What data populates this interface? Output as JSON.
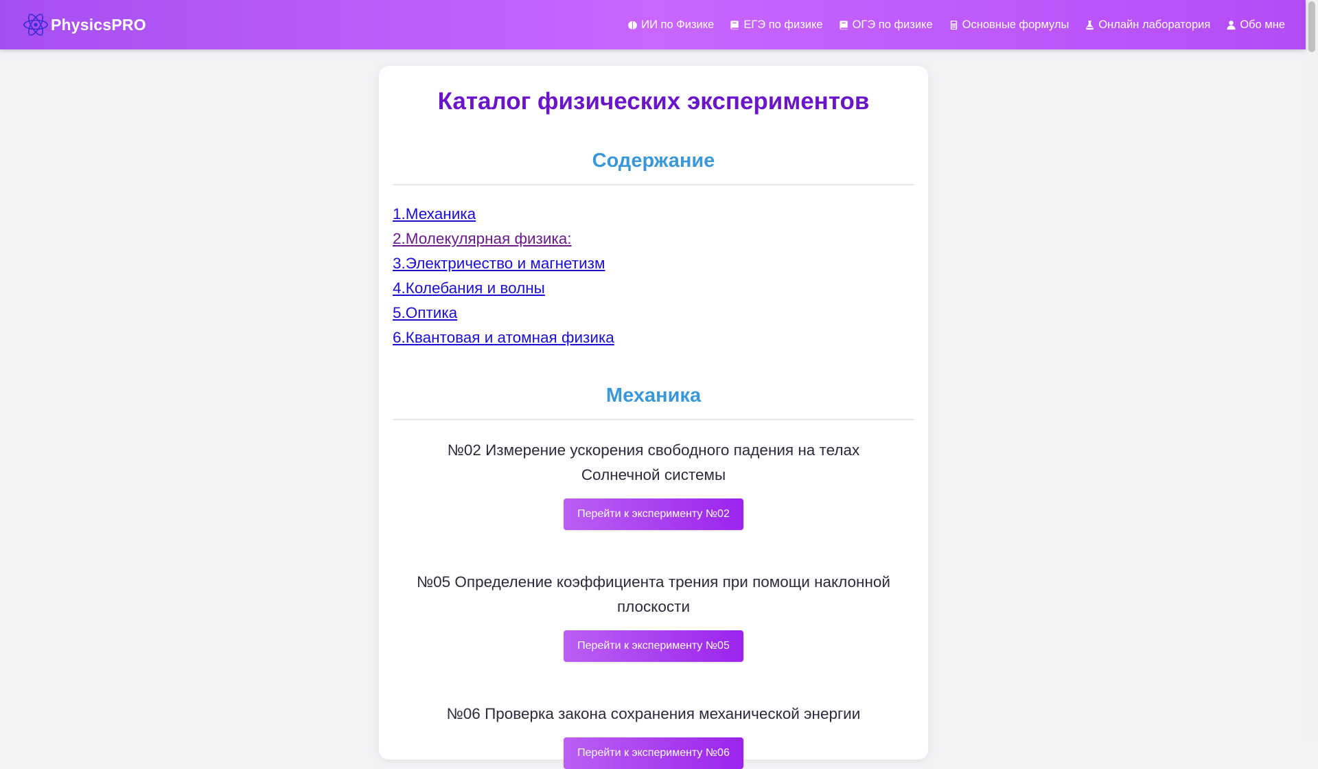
{
  "navbar": {
    "brand": "PhysicsPRO",
    "links": [
      {
        "icon": "brain-icon",
        "label": "ИИ по Физике"
      },
      {
        "icon": "book-icon",
        "label": "ЕГЭ по физике"
      },
      {
        "icon": "book-icon",
        "label": "ОГЭ по физике"
      },
      {
        "icon": "calculator-icon",
        "label": "Основные формулы"
      },
      {
        "icon": "flask-icon",
        "label": "Онлайн лаборатория"
      },
      {
        "icon": "user-icon",
        "label": "Обо мне"
      }
    ]
  },
  "main": {
    "title": "Каталог физических экспериментов",
    "toc_heading": "Содержание",
    "toc": [
      "1.Механика",
      "2.Молекулярная физика:",
      "3.Электричество и магнетизм",
      "4.Колебания и волны",
      "5.Оптика",
      "6.Квантовая и атомная физика"
    ],
    "mechanics_heading": "Механика",
    "experiments": [
      {
        "title": "№02 Измерение ускорения свободного падения на телах Солнечной системы",
        "button": "Перейти к эксперименту №02"
      },
      {
        "title": "№05 Определение коэффициента трения при помощи наклонной плоскости",
        "button": "Перейти к эксперименту №05"
      },
      {
        "title": "№06 Проверка закона сохранения механической энергии",
        "button": "Перейти к эксперименту №06"
      }
    ]
  },
  "colors": {
    "nav_gradient_start": "#a64ff0",
    "nav_gradient_end": "#b44cf6",
    "title": "#6a15c8",
    "section_heading": "#3a98d9",
    "link": "#1a0dd6",
    "visited_link": "#6a1a8c",
    "button_start": "#bb5ff3",
    "button_end": "#9b24ed"
  }
}
